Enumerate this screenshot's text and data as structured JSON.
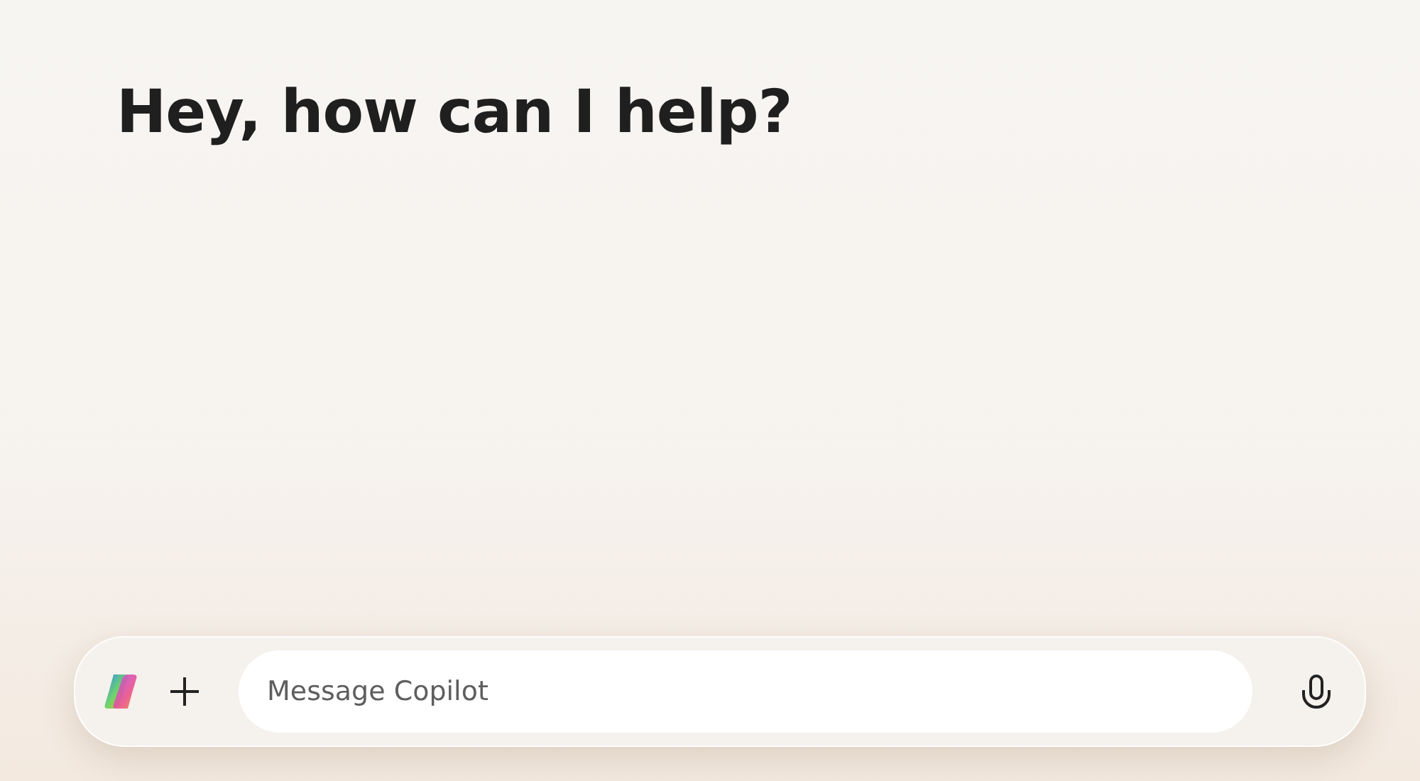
{
  "heading": "Hey, how can I help?",
  "composer": {
    "placeholder": "Message Copilot"
  }
}
